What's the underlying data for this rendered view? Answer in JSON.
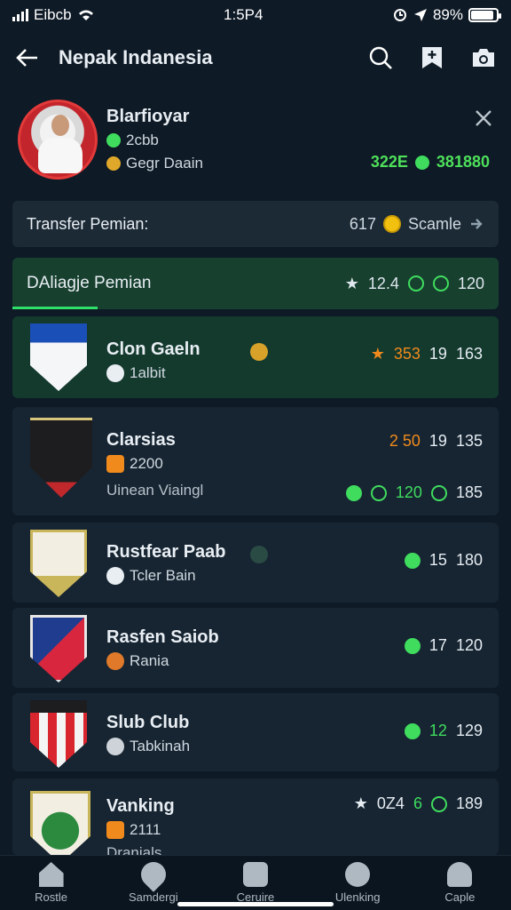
{
  "status": {
    "carrier": "Eibcb",
    "time": "1:5P4",
    "battery": "89%",
    "battery_level": 0.89
  },
  "header": {
    "title": "Nepak Indanesia"
  },
  "profile": {
    "name": "Blarfioyar",
    "level": "2cbb",
    "club": "Gegr Daain",
    "stat_a": "322E",
    "stat_b": "381880",
    "accent": "#4ee05a"
  },
  "transfer": {
    "label": "Transfer Pemian:",
    "count": "617",
    "currency": "Scamle"
  },
  "list_header": {
    "label": "DAliagje Pemian",
    "rating": "12.4",
    "value": "120"
  },
  "clubs": [
    {
      "name": "Clon Gaeln",
      "sub": "1albit",
      "extra": "",
      "rating": "353",
      "a": "19",
      "b": "163"
    },
    {
      "name": "Clarsias",
      "sub": "2200",
      "extra": "Uinean Viaingl",
      "rating": "2 50",
      "a": "19",
      "b": "135",
      "c": "120",
      "d": "185"
    },
    {
      "name": "Rustfear Paab",
      "sub": "Tcler Bain",
      "extra": "",
      "a": "15",
      "b": "180"
    },
    {
      "name": "Rasfen Saiob",
      "sub": "Rania",
      "extra": "",
      "a": "17",
      "b": "120"
    },
    {
      "name": "Slub Club",
      "sub": "Tabkinah",
      "extra": "",
      "a": "12",
      "b": "129"
    },
    {
      "name": "Vanking",
      "sub": "2111",
      "extra": "Dranials",
      "rating": "0Z4",
      "a": "6",
      "b": "189"
    }
  ],
  "nav": [
    {
      "label": "Rostle",
      "icon": "home-icon"
    },
    {
      "label": "Samdergi",
      "icon": "location-icon"
    },
    {
      "label": "Ceruire",
      "icon": "inbox-icon"
    },
    {
      "label": "Ulenking",
      "icon": "key-icon"
    },
    {
      "label": "Caple",
      "icon": "cap-icon"
    }
  ]
}
